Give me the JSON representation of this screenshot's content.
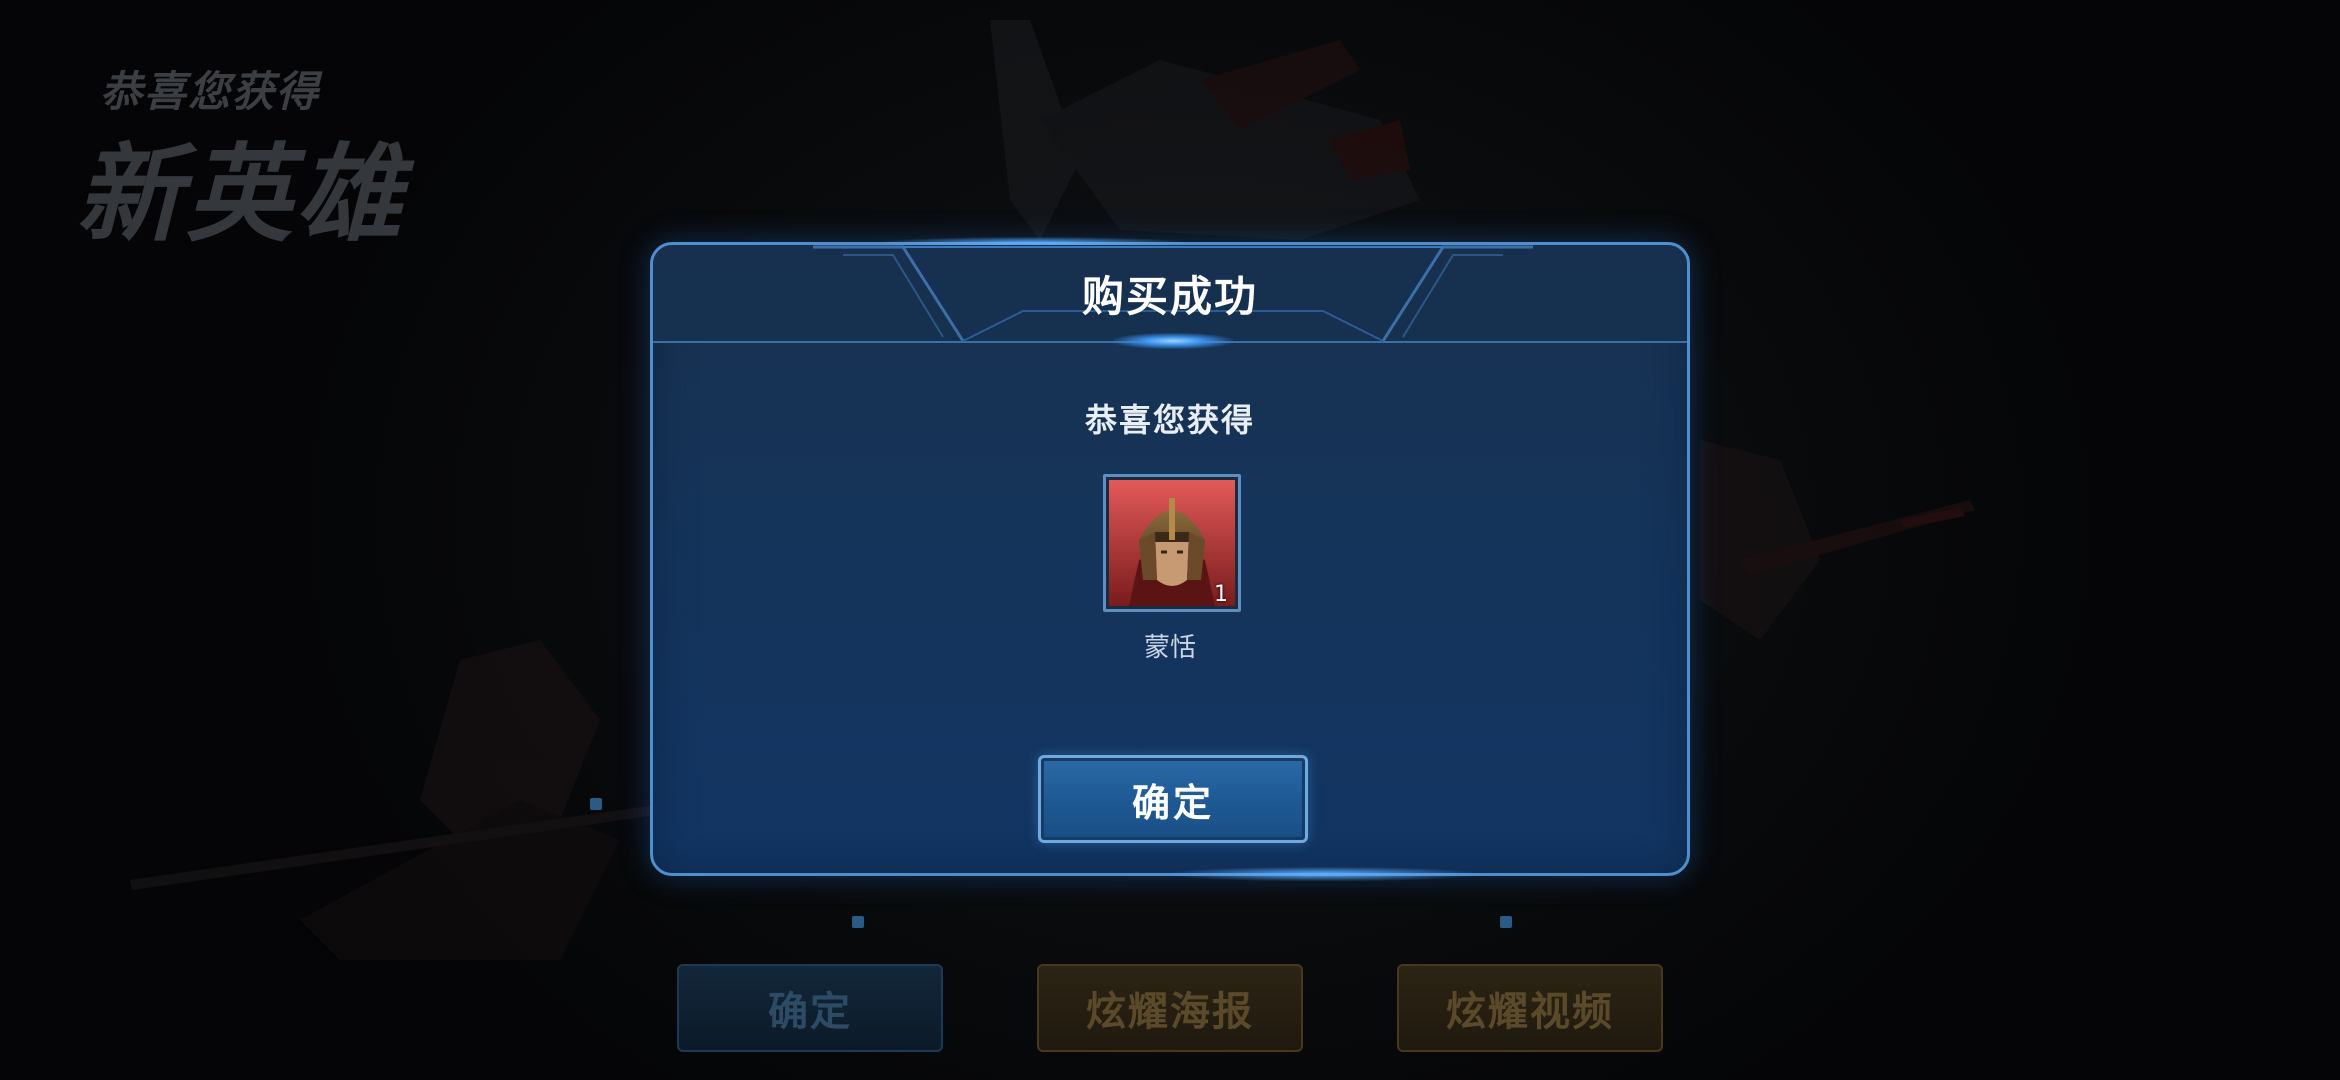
{
  "banner": {
    "subtitle": "恭喜您获得",
    "title": "新英雄"
  },
  "background_buttons": {
    "confirm": "确定",
    "poster": "炫耀海报",
    "video": "炫耀视频"
  },
  "dialog": {
    "title": "购买成功",
    "message": "恭喜您获得",
    "item": {
      "name": "蒙恬",
      "count": "1",
      "icon": "hero-portrait-icon"
    },
    "confirm_label": "确定"
  },
  "colors": {
    "dialog_border": "#4f8fd0",
    "dialog_bg": "#15345a",
    "button_bg": "#1f5a95",
    "gold_button_text": "#5a4a2a"
  }
}
